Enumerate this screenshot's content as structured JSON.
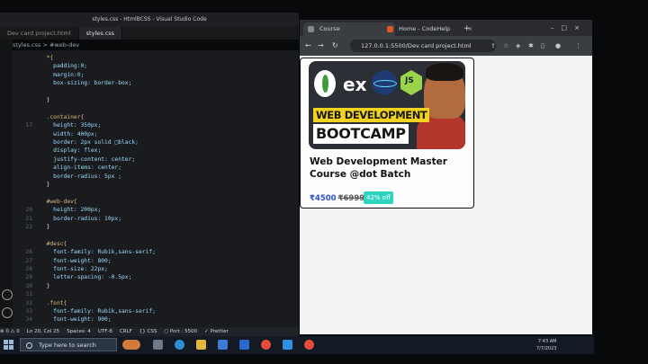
{
  "vscode": {
    "window_title": "styles.css - HtmlBCSS - Visual Studio Code",
    "tabs": [
      {
        "label": "Dev card project.html",
        "active": false
      },
      {
        "label": "styles.css",
        "active": true
      }
    ],
    "breadcrumb": "styles.css > #web-dev",
    "lines": [
      {
        "n": "",
        "text": "  *{"
      },
      {
        "n": "",
        "text": "    padding:0;"
      },
      {
        "n": "",
        "text": "    margin:0;"
      },
      {
        "n": "",
        "text": "    box-sizing: border-box;"
      },
      {
        "n": "",
        "text": ""
      },
      {
        "n": "",
        "text": "  }"
      },
      {
        "n": "",
        "text": ""
      },
      {
        "n": "",
        "text": "  .container{"
      },
      {
        "n": "17",
        "text": "    height: 350px;"
      },
      {
        "n": "",
        "text": "    width: 400px;"
      },
      {
        "n": "",
        "text": "    border: 2px solid □black;"
      },
      {
        "n": "",
        "text": "    display: flex;"
      },
      {
        "n": "",
        "text": "    justify-content: center;"
      },
      {
        "n": "",
        "text": "    align-items: center;"
      },
      {
        "n": "",
        "text": "    border-radius: 5px ;"
      },
      {
        "n": "",
        "text": "  }"
      },
      {
        "n": "",
        "text": ""
      },
      {
        "n": "",
        "text": "  #web-dev{"
      },
      {
        "n": "20",
        "text": "    height: 200px;"
      },
      {
        "n": "21",
        "text": "    border-radius: 10px;"
      },
      {
        "n": "22",
        "text": "  }"
      },
      {
        "n": "",
        "text": ""
      },
      {
        "n": "",
        "text": "  #desc{"
      },
      {
        "n": "26",
        "text": "    font-family: Rubik,sans-serif;"
      },
      {
        "n": "27",
        "text": "    font-weight: 800;"
      },
      {
        "n": "28",
        "text": "    font-size: 22px;"
      },
      {
        "n": "29",
        "text": "    letter-spacing: -0.5px;"
      },
      {
        "n": "30",
        "text": "  }"
      },
      {
        "n": "31",
        "text": ""
      },
      {
        "n": "32",
        "text": "  .font{"
      },
      {
        "n": "33",
        "text": "    font-family: Rubik,sans-serif;"
      },
      {
        "n": "34",
        "text": "    font-weight: 900;"
      }
    ],
    "status": [
      "⊗ 0 ⚠ 0",
      "Ln 20, Col 25",
      "Spaces: 4",
      "UTF-8",
      "CRLF",
      "{} CSS",
      "○ Port : 5500",
      "✓ Prettier"
    ]
  },
  "browser": {
    "tabs": [
      {
        "label": "Course",
        "active": true
      },
      {
        "label": "Home - CodeHelp",
        "active": false
      }
    ],
    "url": "127.0.0.1:5500/Dev card project.html",
    "card": {
      "thumb_texts": {
        "ex": "ex",
        "js": "JS",
        "line1": "WEB DEVELOPMENT",
        "line2": "BOOTCAMP"
      },
      "title": "Web Development Master Course @dot Batch",
      "price": "₹4500",
      "old_price": "₹6999",
      "discount": "42% off"
    }
  },
  "taskbar": {
    "search_placeholder": "Type here to search",
    "time": "7:43 AM",
    "date": "7/7/2023"
  }
}
